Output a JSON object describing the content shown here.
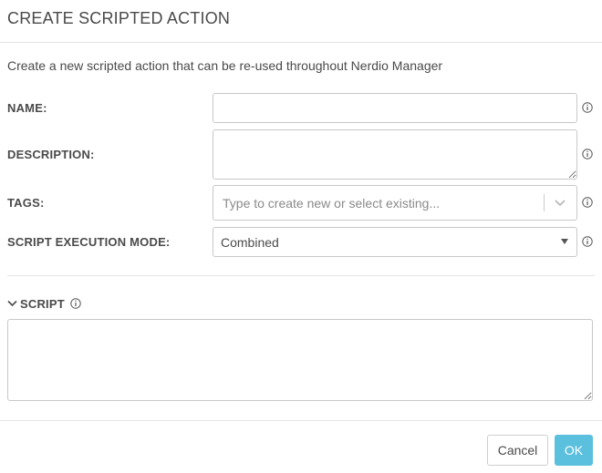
{
  "dialog": {
    "title": "CREATE SCRIPTED ACTION",
    "intro": "Create a new scripted action that can be re-used throughout Nerdio Manager"
  },
  "form": {
    "name": {
      "label": "NAME:",
      "value": ""
    },
    "description": {
      "label": "DESCRIPTION:",
      "value": ""
    },
    "tags": {
      "label": "TAGS:",
      "placeholder": "Type to create new or select existing..."
    },
    "execution_mode": {
      "label": "SCRIPT EXECUTION MODE:",
      "selected": "Combined"
    }
  },
  "script": {
    "label": "SCRIPT",
    "expanded": true,
    "value": ""
  },
  "footer": {
    "cancel_label": "Cancel",
    "ok_label": "OK"
  },
  "colors": {
    "primary_button": "#5bc0de",
    "border": "#c8c8c8",
    "text": "#4a4a4a"
  },
  "icons": {
    "info": "info-circle-icon",
    "tags_dropdown": "chevron-down-icon",
    "select_caret": "caret-down-icon",
    "section_toggle": "chevron-down-icon"
  }
}
